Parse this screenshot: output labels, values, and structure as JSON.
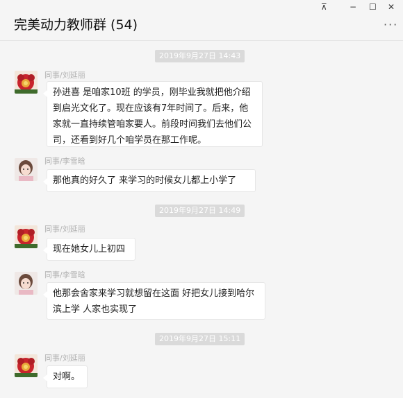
{
  "window": {
    "title": "完美动力教师群 (54)",
    "controls": {
      "pin": "⊼",
      "minimize": "−",
      "maximize": "☐",
      "close": "✕"
    },
    "more": "···"
  },
  "messages": [
    {
      "type": "time",
      "text": "2019年9月27日 14:43"
    },
    {
      "type": "msg",
      "sender": "同事/刘延丽",
      "avatar": "flower-avatar",
      "text": "孙进喜 是咱家10班 的学员，刚毕业我就把他介绍到启光文化了。现在应该有7年时间了。后来，他家就一直持续管咱家要人。前段时间我们去他们公司，还看到好几个咱学员在那工作呢。"
    },
    {
      "type": "msg",
      "sender": "同事/李雪晗",
      "avatar": "girl-avatar",
      "text": "那他真的好久了 来学习的时候女儿都上小学了"
    },
    {
      "type": "time",
      "text": "2019年9月27日 14:49"
    },
    {
      "type": "msg",
      "sender": "同事/刘延丽",
      "avatar": "flower-avatar",
      "text": "现在她女儿上初四"
    },
    {
      "type": "msg",
      "sender": "同事/李雪晗",
      "avatar": "girl-avatar",
      "text": "他那会舍家来学习就想留在这面 好把女儿接到哈尔滨上学  人家也实现了"
    },
    {
      "type": "time",
      "text": "2019年9月27日 15:11"
    },
    {
      "type": "msg",
      "sender": "同事/刘延丽",
      "avatar": "flower-avatar",
      "text": "对啊。"
    }
  ]
}
